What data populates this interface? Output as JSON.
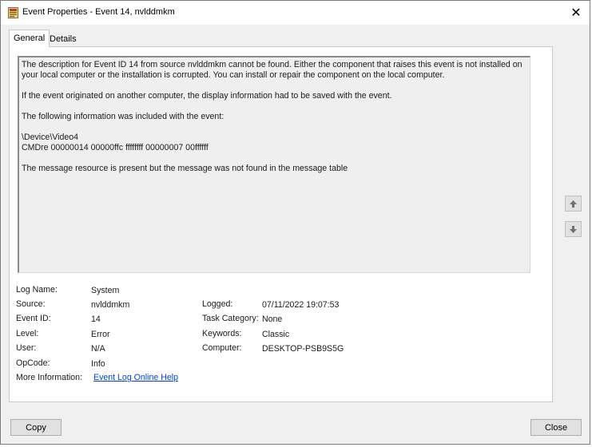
{
  "window": {
    "title": "Event Properties - Event 14, nvlddmkm",
    "close_glyph": "✕"
  },
  "tabs": [
    {
      "label": "General",
      "active": true
    },
    {
      "label": "Details",
      "active": false
    }
  ],
  "description": {
    "p1": "The description for Event ID 14 from source nvlddmkm cannot be found. Either the component that raises this event is not installed on your local computer or the installation is corrupted. You can install or repair the component on the local computer.",
    "p2": "If the event originated on another computer, the display information had to be saved with the event.",
    "p3": "The following information was included with the event:",
    "p4_line1": "\\Device\\Video4",
    "p4_line2": "CMDre 00000014 00000ffc ffffffff 00000007 00ffffff",
    "p5": "The message resource is present but the message was not found in the message table"
  },
  "properties": {
    "log_name": {
      "label": "Log Name:",
      "value": "System"
    },
    "source": {
      "label": "Source:",
      "value": "nvlddmkm"
    },
    "event_id": {
      "label": "Event ID:",
      "value": "14"
    },
    "level": {
      "label": "Level:",
      "value": "Error"
    },
    "user": {
      "label": "User:",
      "value": "N/A"
    },
    "opcode": {
      "label": "OpCode:",
      "value": "Info"
    },
    "more_info": {
      "label": "More Information:",
      "value": "Event Log Online Help"
    },
    "logged": {
      "label": "Logged:",
      "value": "07/11/2022 19:07:53"
    },
    "task_category": {
      "label": "Task Category:",
      "value": "None"
    },
    "keywords": {
      "label": "Keywords:",
      "value": "Classic"
    },
    "computer": {
      "label": "Computer:",
      "value": "DESKTOP-PSB9S5G"
    }
  },
  "buttons": {
    "copy": "Copy",
    "close": "Close"
  },
  "icons": {
    "title": "event-viewer-icon",
    "prev": "arrow-up-icon",
    "next": "arrow-down-icon"
  }
}
